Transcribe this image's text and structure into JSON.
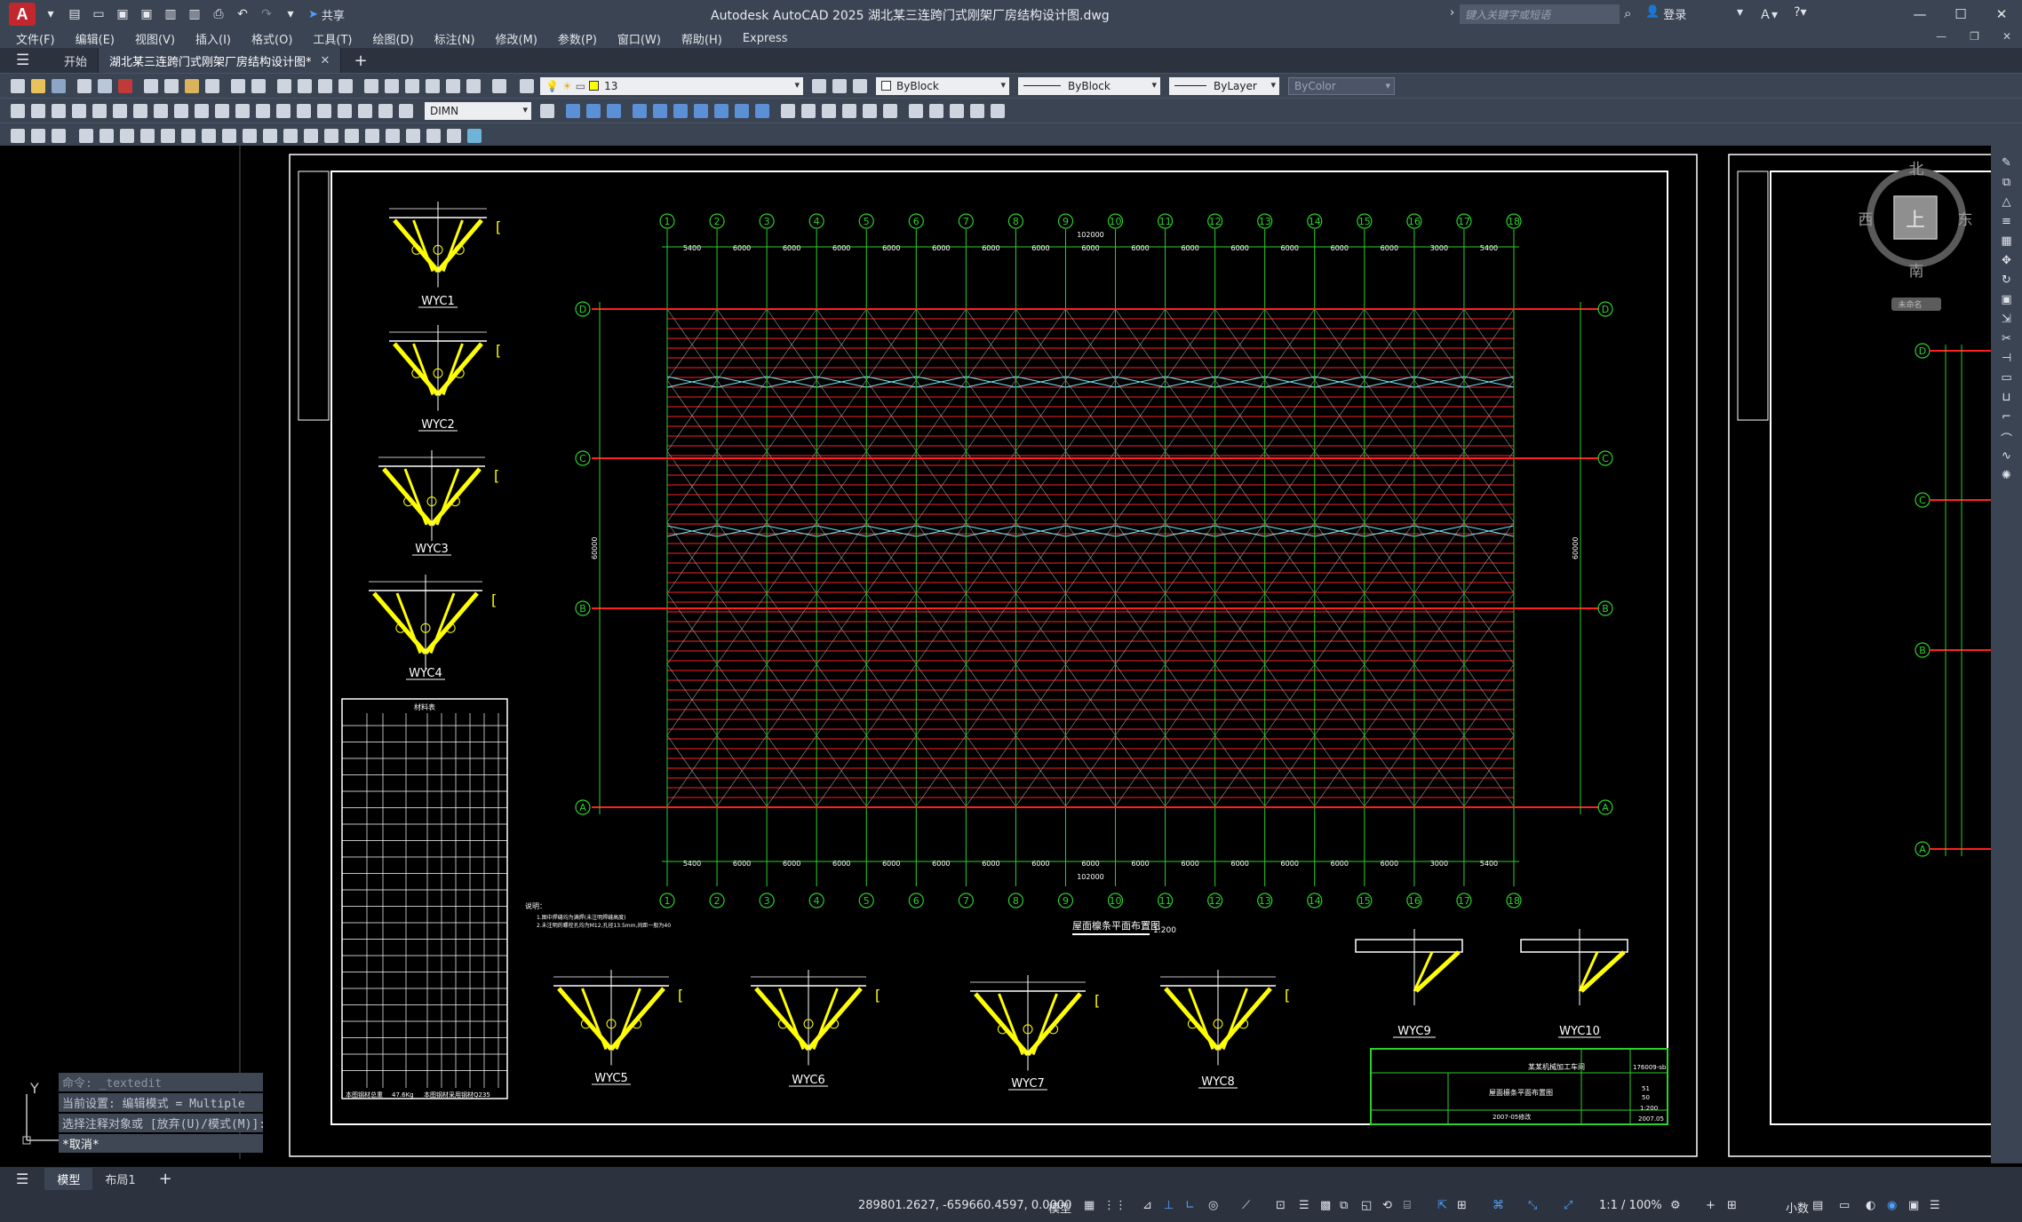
{
  "app": {
    "logo": "A",
    "window_title": "Autodesk AutoCAD 2025    湖北某三连跨门式刚架厂房结构设计图.dwg",
    "share_label": "共享",
    "search_placeholder": "键入关键字或短语",
    "user_label": "登录"
  },
  "menus": [
    "文件(F)",
    "编辑(E)",
    "视图(V)",
    "插入(I)",
    "格式(O)",
    "工具(T)",
    "绘图(D)",
    "标注(N)",
    "修改(M)",
    "参数(P)",
    "窗口(W)",
    "帮助(H)",
    "Express"
  ],
  "tabs": {
    "start_label": "开始",
    "doc_label": "湖北某三连跨门式刚架厂房结构设计图*"
  },
  "toolbar": {
    "layer_value": "13",
    "color_value": "ByBlock",
    "linetype_value": "ByBlock",
    "lineweight_value": "ByLayer",
    "plotstyle_value": "ByColor",
    "dimstyle_value": "DIMN"
  },
  "viewcube": {
    "north": "北",
    "south": "南",
    "east": "东",
    "west": "西",
    "face": "上",
    "wcs": "未命名"
  },
  "drawing": {
    "grid_columns": [
      "1",
      "2",
      "3",
      "4",
      "5",
      "6",
      "7",
      "8",
      "9",
      "10",
      "11",
      "12",
      "13",
      "14",
      "15",
      "16",
      "17",
      "18"
    ],
    "grid_rows": [
      "D",
      "C",
      "B",
      "A"
    ],
    "span_dims": [
      "5400",
      "6000",
      "6000",
      "6000",
      "6000",
      "6000",
      "6000",
      "6000",
      "6000",
      "6000",
      "6000",
      "6000",
      "6000",
      "6000",
      "6000",
      "3000",
      "5400"
    ],
    "total_length": "102000",
    "total_width": "60000",
    "plan_caption": "屋面檩条平面布置图",
    "plan_scale": "1:200",
    "details": [
      "WYC1",
      "WYC2",
      "WYC3",
      "WYC4",
      "WYC5",
      "WYC6",
      "WYC7",
      "WYC8",
      "WYC9",
      "WYC10"
    ],
    "table_title": "材料表",
    "table_footer_left": "本图钢材总重",
    "table_footer_weight": "47.6Kg",
    "table_footer_right": "本图钢材采用钢材Q235",
    "notes": [
      "说明：",
      "1.图中焊缝均为满焊(未注明焊缝高度)",
      "2.未注明的螺栓孔均为M12,孔径13.5mm,间距一般为40"
    ],
    "title_block": {
      "project": "屋面檩条平面布置图",
      "company": "某某机械加工车间",
      "drawing_no": "176009-sb",
      "date": "2007-05修改",
      "scale": "1:200",
      "year": "2007.05",
      "sheet": "51",
      "sheet2": "50"
    }
  },
  "command": {
    "line1": "命令: _textedit",
    "line2": "当前设置: 编辑模式 = Multiple",
    "line3": "选择注释对象或 [放弃(U)/模式(M)]:",
    "line4": "*取消*"
  },
  "layout_tabs": [
    "模型",
    "布局1"
  ],
  "status": {
    "coords": "289801.2627, -659660.4597, 0.0000",
    "model": "模型",
    "scale": "1:1 / 100%",
    "units": "小数"
  }
}
